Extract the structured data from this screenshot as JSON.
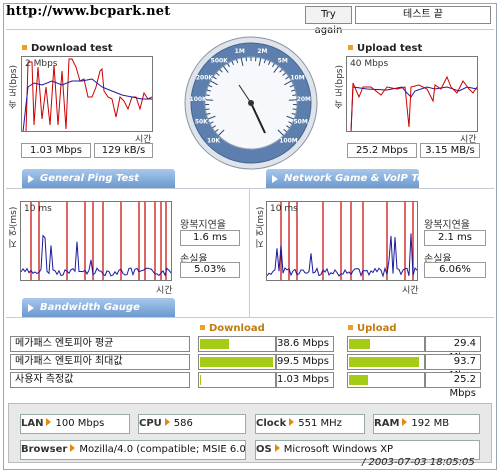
{
  "header": {
    "site_url": "http://www.bcpark.net",
    "try_again_label": "Try again",
    "test_end_label": "테스트 끝"
  },
  "download": {
    "title": "Download test",
    "axis_label": "속 도(bps)",
    "scale_label": "2 Mbps",
    "time_label": "시간",
    "speed_bps": "1.03 Mbps",
    "speed_bytes": "129 kB/s"
  },
  "upload": {
    "title": "Upload test",
    "axis_label": "속 도(bps)",
    "scale_label": "40 Mbps",
    "time_label": "시간",
    "speed_bps": "25.2 Mbps",
    "speed_bytes": "3.15 MB/s"
  },
  "gauge": {
    "scale_labels": [
      "10K",
      "50K",
      "100K",
      "200K",
      "500K",
      "1M",
      "2M",
      "5M",
      "10M",
      "20M",
      "50M",
      "100M"
    ]
  },
  "ping_general": {
    "banner": "General Ping Test",
    "axis_label": "지 연(ms)",
    "scale_label": "10 ms",
    "time_label": "시간",
    "latency_label": "왕복지연율",
    "latency_value": "1.6 ms",
    "loss_label": "손실율",
    "loss_value": "5.03%"
  },
  "ping_game": {
    "banner": "Network Game & VoIP Test",
    "axis_label": "지 연(ms)",
    "scale_label": "10 ms",
    "time_label": "시간",
    "latency_label": "왕복지연율",
    "latency_value": "2.1 ms",
    "loss_label": "손실율",
    "loss_value": "6.06%"
  },
  "bandwidth": {
    "banner": "Bandwidth Gauge",
    "download_header": "Download",
    "upload_header": "Upload",
    "rows": [
      {
        "label": "메가패스 엔토피아 평균",
        "download": "38.6 Mbps",
        "download_fill": 0.39,
        "upload": "29.4 Mbps",
        "upload_fill": 0.29
      },
      {
        "label": "메가패스 엔토피아 최대값",
        "download": "99.5 Mbps",
        "download_fill": 0.99,
        "upload": "93.7 Mbps",
        "upload_fill": 0.94
      },
      {
        "label": "사용자 측정값",
        "download": "1.03 Mbps",
        "download_fill": 0.01,
        "upload": "25.2 Mbps",
        "upload_fill": 0.25
      }
    ]
  },
  "system": {
    "lan_label": "LAN",
    "lan_value": "100 Mbps",
    "cpu_label": "CPU",
    "cpu_value": "586",
    "clock_label": "Clock",
    "clock_value": "551 MHz",
    "ram_label": "RAM",
    "ram_value": "192 MB",
    "browser_label": "Browser",
    "browser_value": "Mozilla/4.0 (compatible; MSIE 6.0",
    "os_label": "OS",
    "os_value": "Microsoft Windows XP"
  },
  "timestamp": "/ 2003-07-03 18:05:05",
  "colors": {
    "accent_orange": "#f0a020",
    "bar_green": "#a4cc16",
    "banner_blue": "#6b98cf",
    "trace_red": "#cc0000",
    "trace_blue": "#1a1aa0"
  }
}
